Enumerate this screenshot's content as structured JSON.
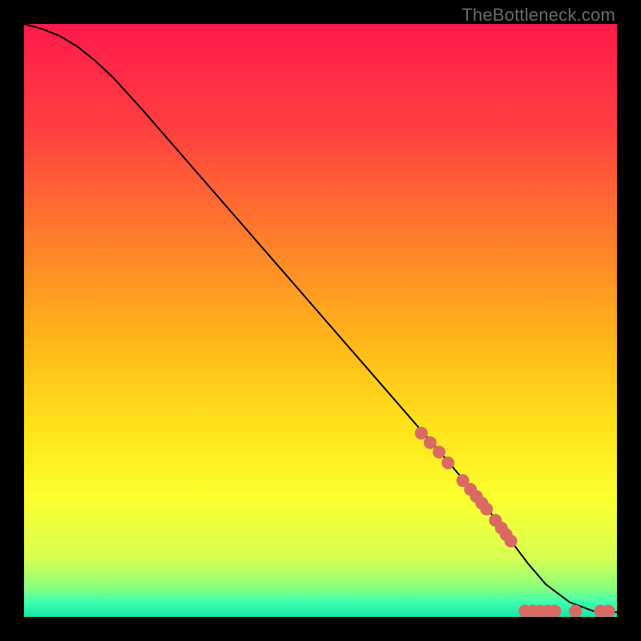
{
  "watermark": "TheBottleneck.com",
  "chart_data": {
    "type": "line",
    "title": "",
    "xlabel": "",
    "ylabel": "",
    "xlim": [
      0,
      100
    ],
    "ylim": [
      0,
      100
    ],
    "grid": false,
    "legend": false,
    "background_gradient": {
      "stops": [
        {
          "offset": 0.0,
          "color": "#ff1a4b"
        },
        {
          "offset": 0.18,
          "color": "#ff4040"
        },
        {
          "offset": 0.35,
          "color": "#ff7a2d"
        },
        {
          "offset": 0.52,
          "color": "#ffb21a"
        },
        {
          "offset": 0.68,
          "color": "#ffe31a"
        },
        {
          "offset": 0.8,
          "color": "#fcff2e"
        },
        {
          "offset": 0.9,
          "color": "#d8ff52"
        },
        {
          "offset": 0.95,
          "color": "#8cff7a"
        },
        {
          "offset": 0.975,
          "color": "#3effb0"
        },
        {
          "offset": 1.0,
          "color": "#15e6a8"
        }
      ]
    },
    "series": [
      {
        "name": "curve",
        "type": "line",
        "color": "#000000",
        "x": [
          0,
          3,
          6,
          9,
          12,
          15,
          20,
          30,
          40,
          50,
          60,
          70,
          78,
          82,
          85,
          88,
          92,
          96,
          100
        ],
        "y": [
          100,
          99.2,
          98.0,
          96.2,
          93.8,
          91.0,
          85.5,
          74.0,
          62.5,
          51.0,
          39.5,
          28.0,
          18.5,
          13.0,
          9.0,
          5.5,
          2.5,
          1.0,
          0.8
        ]
      },
      {
        "name": "highlight-points",
        "type": "scatter",
        "color": "#d96a63",
        "radius": 8,
        "points": [
          {
            "x": 67.0,
            "y": 31.0
          },
          {
            "x": 68.5,
            "y": 29.4
          },
          {
            "x": 70.0,
            "y": 27.8
          },
          {
            "x": 71.5,
            "y": 26.0
          },
          {
            "x": 74.0,
            "y": 23.0
          },
          {
            "x": 75.3,
            "y": 21.5
          },
          {
            "x": 76.3,
            "y": 20.3
          },
          {
            "x": 77.2,
            "y": 19.2
          },
          {
            "x": 78.0,
            "y": 18.2
          },
          {
            "x": 79.5,
            "y": 16.3
          },
          {
            "x": 80.5,
            "y": 15.0
          },
          {
            "x": 81.3,
            "y": 13.9
          },
          {
            "x": 82.1,
            "y": 12.8
          },
          {
            "x": 84.5,
            "y": 1.0
          },
          {
            "x": 85.8,
            "y": 1.0
          },
          {
            "x": 87.0,
            "y": 1.0
          },
          {
            "x": 88.3,
            "y": 1.0
          },
          {
            "x": 89.5,
            "y": 1.0
          },
          {
            "x": 93.0,
            "y": 1.0
          },
          {
            "x": 97.2,
            "y": 1.0
          },
          {
            "x": 98.6,
            "y": 1.0
          }
        ]
      }
    ]
  }
}
